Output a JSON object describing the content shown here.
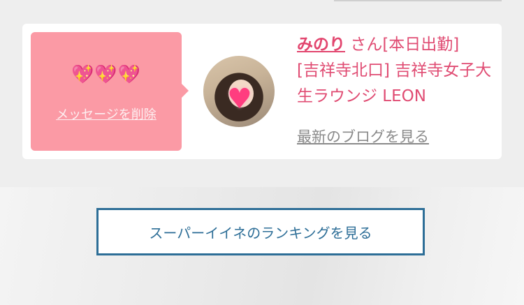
{
  "card": {
    "hearts": "💖💖💖",
    "delete_label": "メッセージを削除",
    "name": "みのり",
    "honorific": "さん",
    "status": "[本日出勤]",
    "shop": "[吉祥寺北口] 吉祥寺女子大生ラウンジ LEON",
    "blog_label": "最新のブログを見る",
    "avatar_overlay_icon": "heart-icon"
  },
  "ranking": {
    "button_label": "スーパーイイネのランキングを見る"
  },
  "colors": {
    "accent_pink": "#e04c73",
    "bubble_pink": "#fb9aa5",
    "button_blue": "#2d6e97"
  }
}
